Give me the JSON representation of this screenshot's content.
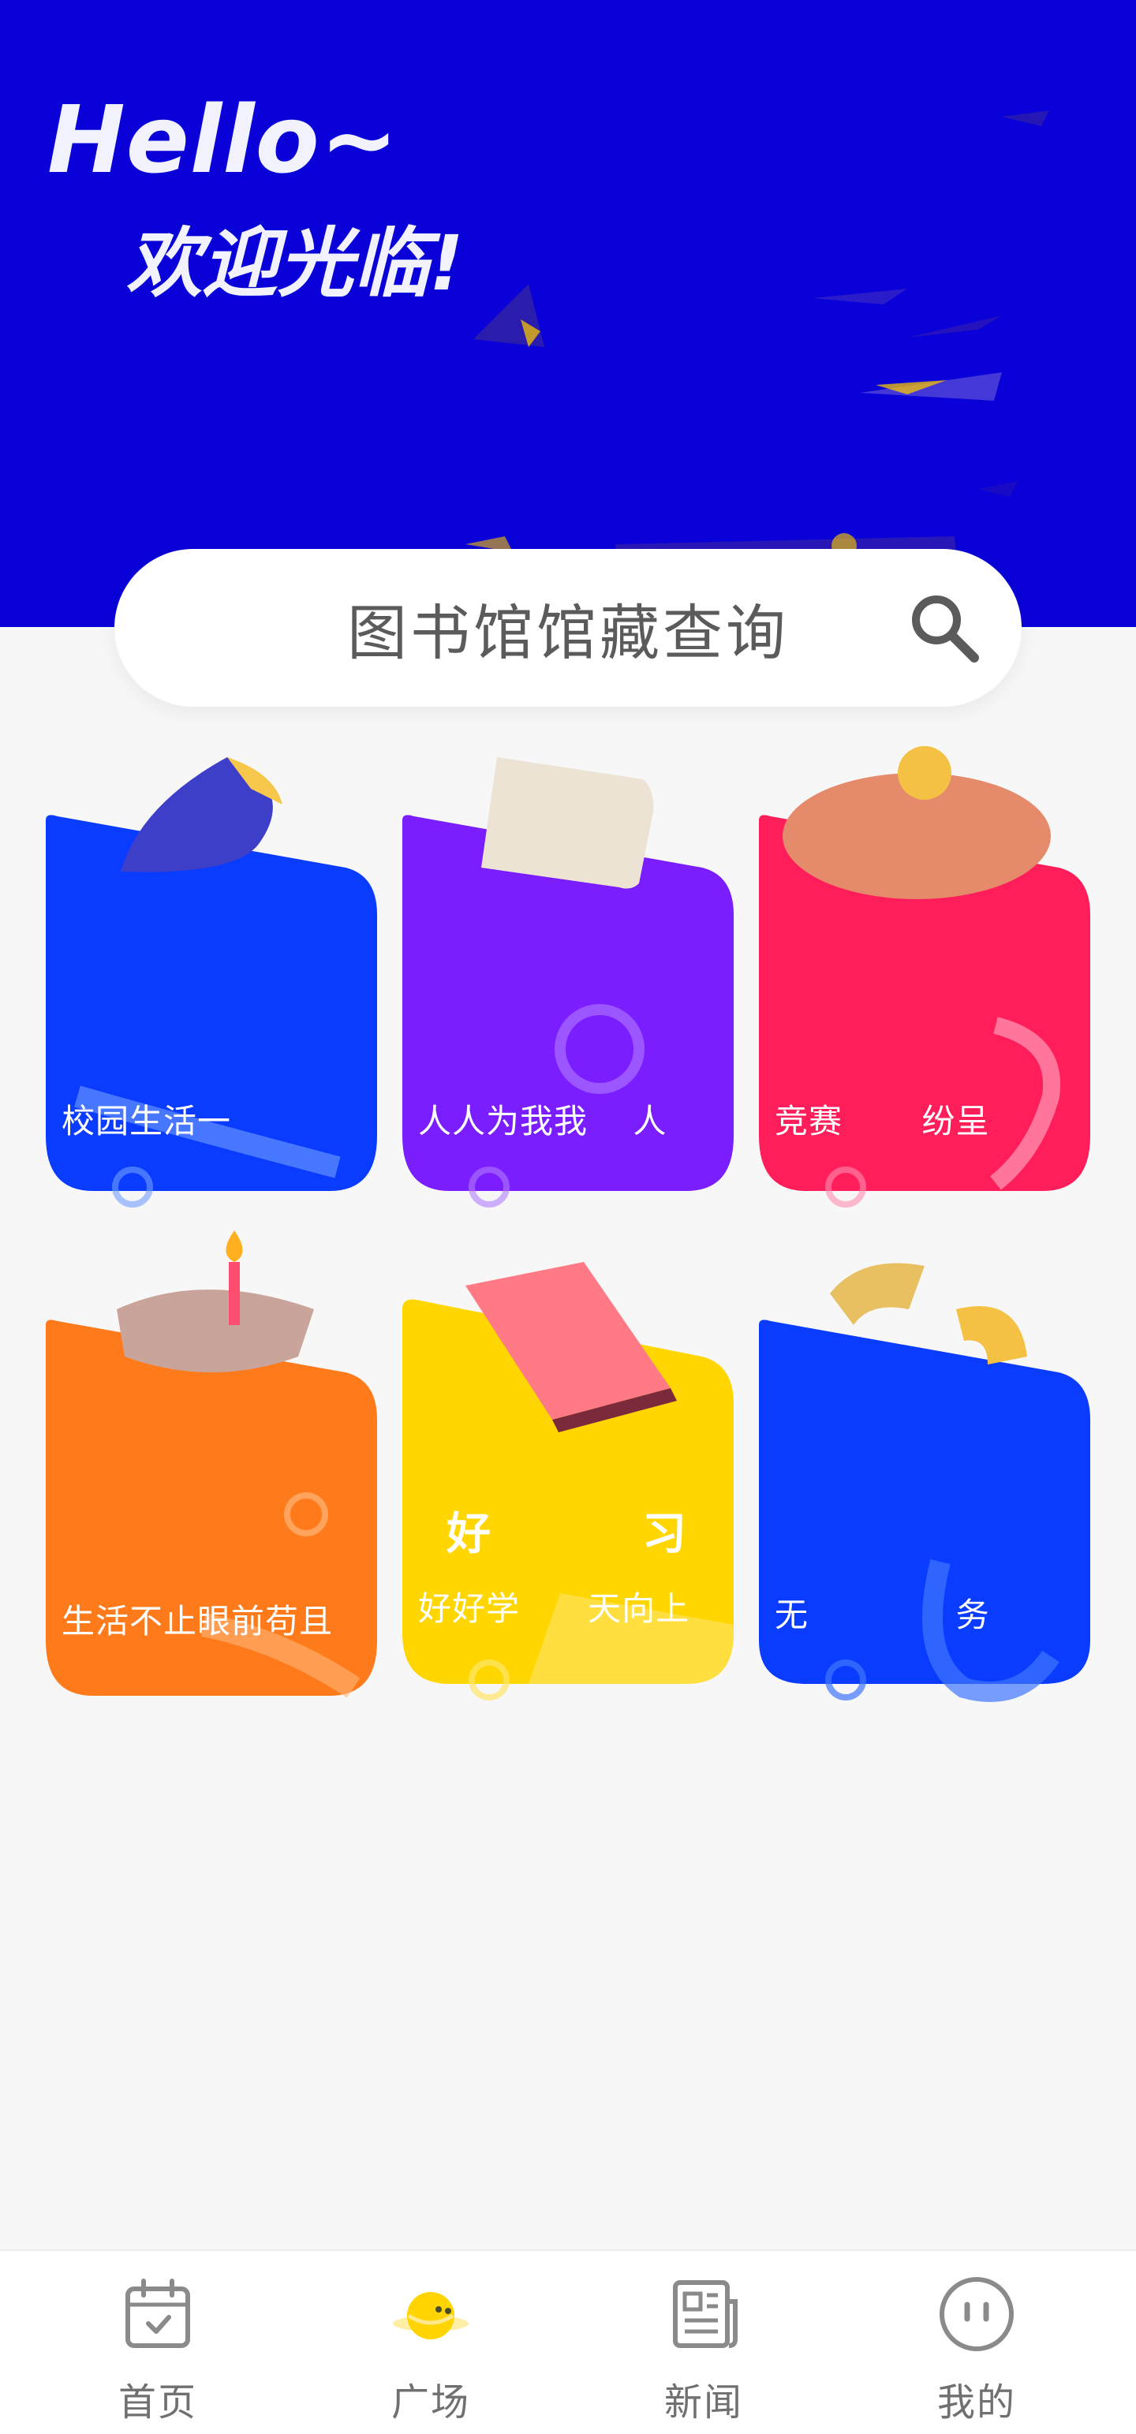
{
  "hero": {
    "greeting": "Hello~",
    "welcome": "欢迎光临!"
  },
  "search": {
    "placeholder": "图书馆馆藏查询",
    "icon": "search-icon"
  },
  "cards": [
    {
      "title": "",
      "subtitle": "校园生活一",
      "color": "#0a3cff",
      "icon": "rocket-icon"
    },
    {
      "title": "",
      "subtitle": "人人为我我",
      "subtitle2": "人",
      "color": "#7a1dff",
      "icon": "book-icon"
    },
    {
      "title": "",
      "subtitle": "竞赛",
      "subtitle2": "纷呈",
      "color": "#ff1e5a",
      "icon": "piggy-bank-icon"
    },
    {
      "title": "",
      "subtitle": "生活不止眼前苟且",
      "color": "#ff7a1a",
      "icon": "cake-icon"
    },
    {
      "title": "好",
      "title2": "习",
      "subtitle": "好好学",
      "subtitle2": "天向上",
      "color": "#ffd600",
      "icon": "notebook-icon"
    },
    {
      "title": "",
      "subtitle": "无",
      "subtitle2": "务",
      "color": "#0a3cff",
      "icon": "magnet-icon"
    }
  ],
  "nav": {
    "items": [
      {
        "label": "首页",
        "icon": "calendar-icon"
      },
      {
        "label": "广场",
        "icon": "planet-icon"
      },
      {
        "label": "新闻",
        "icon": "newspaper-icon"
      },
      {
        "label": "我的",
        "icon": "profile-face-icon"
      }
    ],
    "active_index": 1
  },
  "colors": {
    "hero_bg": "#0a00d8",
    "page_bg": "#f7f7f8",
    "nav_active": "#ffd400",
    "nav_inactive": "#8a8a8a"
  }
}
